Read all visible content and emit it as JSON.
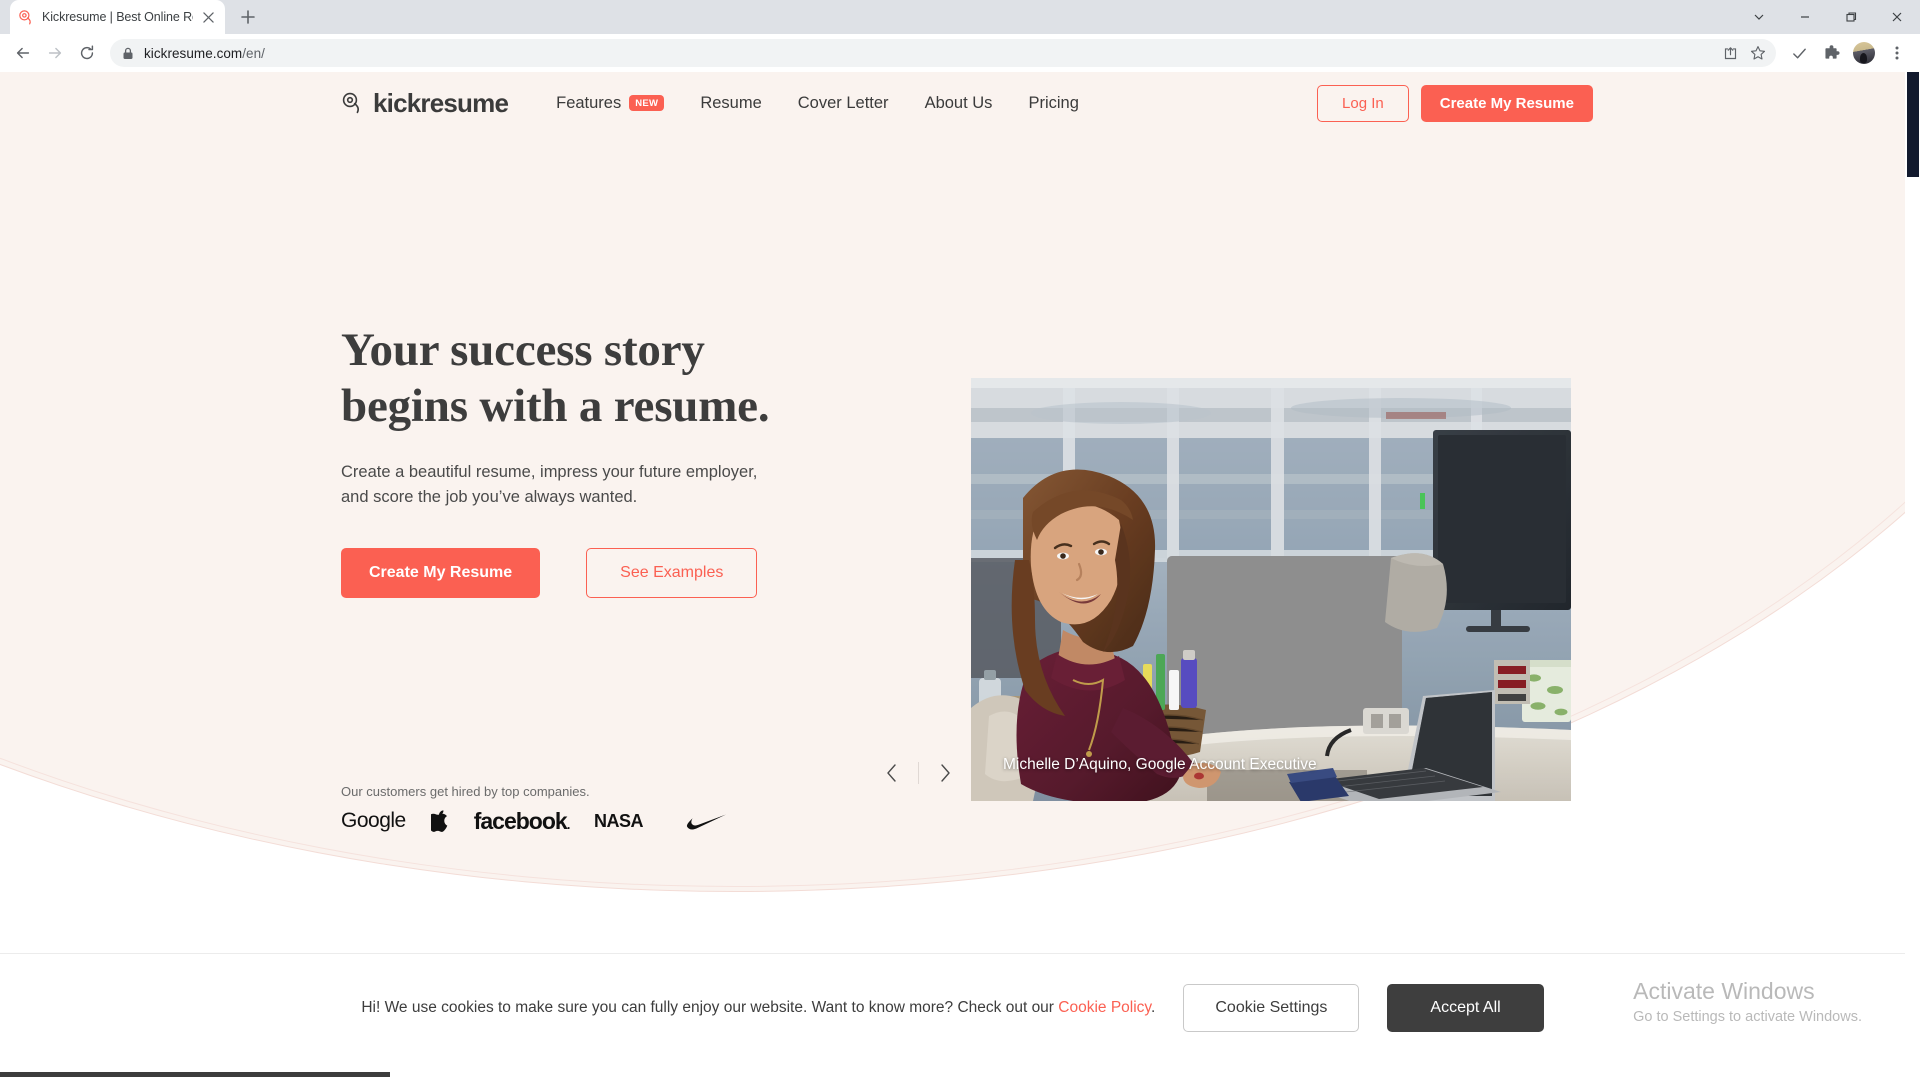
{
  "browser": {
    "tab": {
      "title": "Kickresume | Best Online Resume",
      "favicon": "kickresume-icon",
      "close": "close-tab-icon"
    },
    "new_tab": "+",
    "window_controls": {
      "tab_search": "chevron-down-icon",
      "minimize": "minimize-icon",
      "maximize": "maximize-icon",
      "close": "close-window-icon"
    },
    "nav": {
      "back": "back-arrow-icon",
      "forward": "forward-arrow-icon",
      "reload": "reload-icon"
    },
    "omnibox": {
      "lock": "lock-icon",
      "url_domain": "kickresume.com",
      "url_path": "/en/",
      "share": "share-icon",
      "bookmark": "star-icon"
    },
    "toolbar_right": {
      "check": "checkmark-icon",
      "extensions": "puzzle-icon",
      "profile": "avatar",
      "menu": "three-dot-menu-icon"
    }
  },
  "site": {
    "logo": {
      "text": "kickresume",
      "mark": "kickresume-mark-icon"
    },
    "nav_links": [
      {
        "label": "Features",
        "badge": "NEW"
      },
      {
        "label": "Resume"
      },
      {
        "label": "Cover Letter"
      },
      {
        "label": "About Us"
      },
      {
        "label": "Pricing"
      }
    ],
    "login_label": "Log In",
    "create_label": "Create My Resume"
  },
  "hero": {
    "title_line1": "Your success story",
    "title_line2": "begins with a resume.",
    "subtitle_line1": "Create a beautiful resume, impress your future employer,",
    "subtitle_line2": "and score the job you’ve always wanted.",
    "cta_primary": "Create My Resume",
    "cta_secondary": "See Examples",
    "customers_label": "Our customers get hired by top companies.",
    "company_logos": [
      "Google",
      "apple-logo",
      "facebook",
      "NASA",
      "nike-swoosh"
    ],
    "photo_caption": "Michelle D’Aquino, Google Account Executive",
    "carousel": {
      "prev": "chevron-left-icon",
      "next": "chevron-right-icon"
    }
  },
  "cookie_banner": {
    "text_before_link": "Hi! We use cookies to make sure you can fully enjoy our website. Want to know more? Check out our ",
    "link_label": "Cookie Policy",
    "text_after_link": ".",
    "settings_label": "Cookie Settings",
    "accept_label": "Accept All"
  },
  "watermark": {
    "title": "Activate Windows",
    "subtitle": "Go to Settings to activate Windows."
  },
  "colors": {
    "brand_coral": "#fb6052",
    "hero_cream": "#faf3ef",
    "text_dark": "#3d3d3d",
    "accept_dark": "#3e3e3e"
  }
}
